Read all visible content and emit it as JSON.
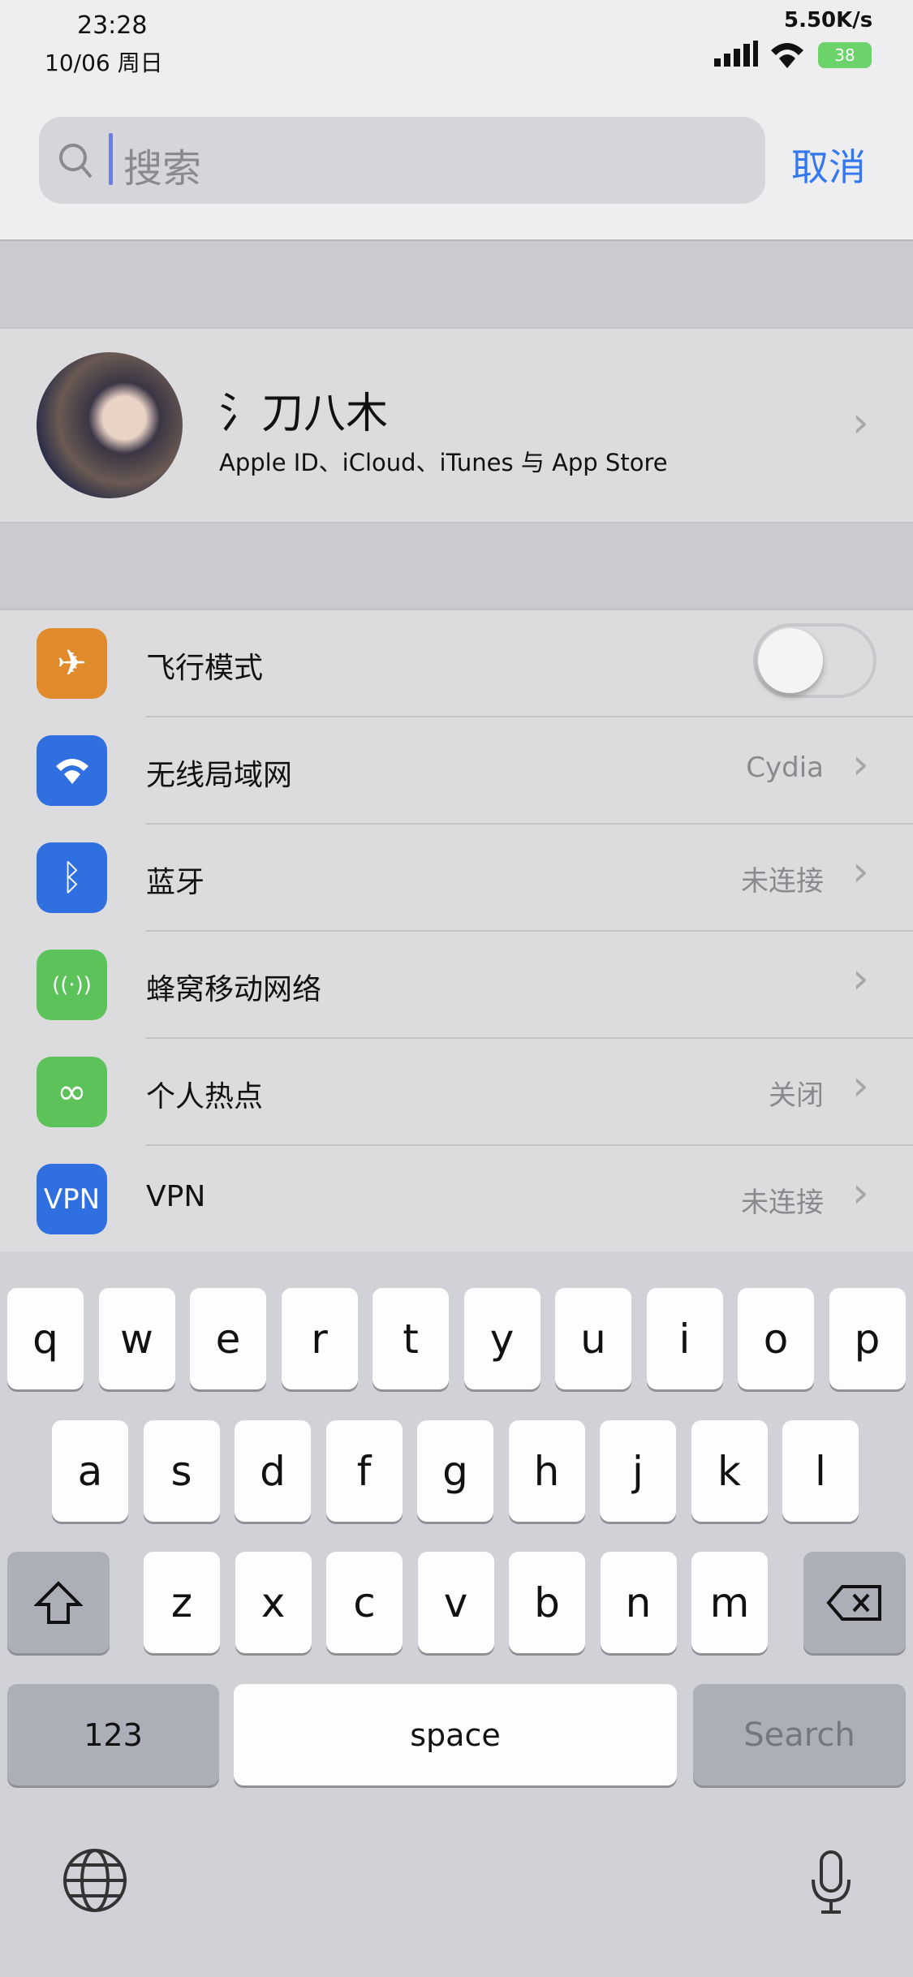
{
  "status": {
    "time": "23:28",
    "date": "10/06 周日",
    "speed": "5.50K/s",
    "battery": "38",
    "battery_color": "#6cd36a"
  },
  "search": {
    "placeholder": "搜索",
    "cancel": "取消"
  },
  "profile": {
    "name": "氵刀八木",
    "subtitle": "Apple ID、iCloud、iTunes 与 App Store"
  },
  "settings": [
    {
      "label": "飞行模式",
      "icon": "airplane-icon",
      "color": "#e08a2c",
      "toggle": false
    },
    {
      "label": "无线局域网",
      "icon": "wifi-icon",
      "color": "#2f6fe0",
      "value": "Cydia"
    },
    {
      "label": "蓝牙",
      "icon": "bluetooth-icon",
      "color": "#2f6fe0",
      "value": "未连接"
    },
    {
      "label": "蜂窝移动网络",
      "icon": "cellular-icon",
      "color": "#5cc25a",
      "value": ""
    },
    {
      "label": "个人热点",
      "icon": "hotspot-icon",
      "color": "#5cc25a",
      "value": "关闭"
    },
    {
      "label": "VPN",
      "icon": "vpn-icon",
      "icon_text": "VPN",
      "color": "#2f6fe0",
      "value": "未连接"
    }
  ],
  "keyboard": {
    "row1": [
      "q",
      "w",
      "e",
      "r",
      "t",
      "y",
      "u",
      "i",
      "o",
      "p"
    ],
    "row2": [
      "a",
      "s",
      "d",
      "f",
      "g",
      "h",
      "j",
      "k",
      "l"
    ],
    "row3": [
      "z",
      "x",
      "c",
      "v",
      "b",
      "n",
      "m"
    ],
    "numbers": "123",
    "space": "space",
    "search": "Search"
  }
}
